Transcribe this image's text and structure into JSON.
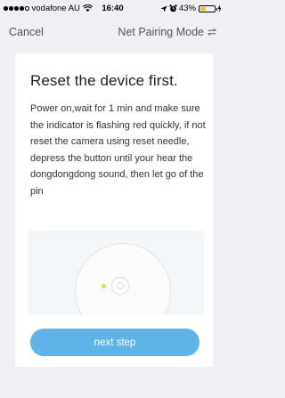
{
  "status_bar": {
    "carrier": "vodafone AU",
    "time": "16:40",
    "battery": "43%",
    "battery_level": 0.43,
    "icons": [
      "signal-dots-icon",
      "wifi-icon",
      "location-arrow-icon",
      "alarm-icon",
      "battery-icon",
      "charging-icon"
    ]
  },
  "nav": {
    "cancel_label": "Cancel",
    "mode_label": "Net Pairing Mode",
    "mode_icon": "switch-arrows-icon"
  },
  "card": {
    "title": "Reset the device first.",
    "description": "Power on,wait for 1 min and make sure the indicator is flashing red quickly, if not reset the camera using reset needle, depress the button until your hear the dongdongdong sound, then let go of the pin",
    "illustration": "camera-illustration",
    "next_label": "next step"
  },
  "colors": {
    "background": "#efeff4",
    "button": "#5eb4e6",
    "indicator": "#f2d83a",
    "battery": "#f5c400"
  }
}
